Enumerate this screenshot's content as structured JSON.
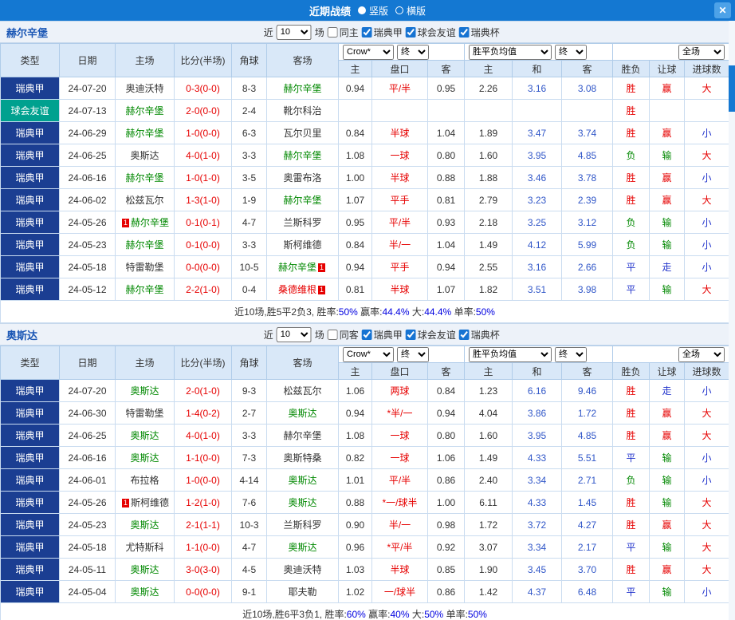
{
  "titlebar": {
    "title": "近期战绩",
    "radio_vertical": "竖版",
    "radio_horizontal": "横版",
    "close": "✕"
  },
  "table_header": {
    "type": "类型",
    "date": "日期",
    "home": "主场",
    "score": "比分(半场)",
    "corners": "角球",
    "away": "客场",
    "odds_select": "Crow*",
    "final_select": "终",
    "avg_select": "胜平负均值",
    "scope_select": "全场",
    "h": "主",
    "hcap": "盘口",
    "a": "客",
    "h2": "主",
    "d": "和",
    "a2": "客",
    "result": "胜负",
    "handicap": "让球",
    "goals": "进球数"
  },
  "sections": [
    {
      "team": "赫尔辛堡",
      "filter": {
        "near": "近",
        "count": "10",
        "games": "场",
        "same": "同主",
        "same_checked": false,
        "leagues": [
          {
            "label": "瑞典甲",
            "checked": true
          },
          {
            "label": "球会友谊",
            "checked": true
          },
          {
            "label": "瑞典杯",
            "checked": true
          }
        ]
      },
      "rows": [
        {
          "league": "瑞典甲",
          "lcls": "league",
          "date": "24-07-20",
          "home": "奥迪沃特",
          "hcls": "n",
          "hbadge": "",
          "score": "0-3(0-0)",
          "corners": "8-3",
          "away": "赫尔辛堡",
          "acls": "g",
          "abadge": "",
          "o_h": "0.94",
          "o_line": "平/半",
          "o_a": "0.95",
          "m_h": "2.26",
          "m_d": "3.16",
          "m_a": "3.08",
          "res": "胜",
          "rescls": "w",
          "hdp": "赢",
          "hdpcls": "w",
          "size": "大",
          "sizecls": "b"
        },
        {
          "league": "球会友谊",
          "lcls": "friendly",
          "date": "24-07-13",
          "home": "赫尔辛堡",
          "hcls": "g",
          "hbadge": "",
          "score": "2-0(0-0)",
          "corners": "2-4",
          "away": "靴尔科治",
          "acls": "n",
          "abadge": "",
          "o_h": "",
          "o_line": "",
          "o_a": "",
          "m_h": "",
          "m_d": "",
          "m_a": "",
          "res": "胜",
          "rescls": "w",
          "hdp": "",
          "hdpcls": "",
          "size": "",
          "sizecls": ""
        },
        {
          "league": "瑞典甲",
          "lcls": "league",
          "date": "24-06-29",
          "home": "赫尔辛堡",
          "hcls": "g",
          "hbadge": "",
          "score": "1-0(0-0)",
          "corners": "6-3",
          "away": "瓦尔贝里",
          "acls": "n",
          "abadge": "",
          "o_h": "0.84",
          "o_line": "半球",
          "o_a": "1.04",
          "m_h": "1.89",
          "m_d": "3.47",
          "m_a": "3.74",
          "res": "胜",
          "rescls": "w",
          "hdp": "赢",
          "hdpcls": "w",
          "size": "小",
          "sizecls": "s"
        },
        {
          "league": "瑞典甲",
          "lcls": "league",
          "date": "24-06-25",
          "home": "奥斯达",
          "hcls": "n",
          "hbadge": "",
          "score": "4-0(1-0)",
          "corners": "3-3",
          "away": "赫尔辛堡",
          "acls": "g",
          "abadge": "",
          "o_h": "1.08",
          "o_line": "一球",
          "o_a": "0.80",
          "m_h": "1.60",
          "m_d": "3.95",
          "m_a": "4.85",
          "res": "负",
          "rescls": "l",
          "hdp": "输",
          "hdpcls": "l",
          "size": "大",
          "sizecls": "b"
        },
        {
          "league": "瑞典甲",
          "lcls": "league",
          "date": "24-06-16",
          "home": "赫尔辛堡",
          "hcls": "g",
          "hbadge": "",
          "score": "1-0(1-0)",
          "corners": "3-5",
          "away": "奥雷布洛",
          "acls": "n",
          "abadge": "",
          "o_h": "1.00",
          "o_line": "半球",
          "o_a": "0.88",
          "m_h": "1.88",
          "m_d": "3.46",
          "m_a": "3.78",
          "res": "胜",
          "rescls": "w",
          "hdp": "赢",
          "hdpcls": "w",
          "size": "小",
          "sizecls": "s"
        },
        {
          "league": "瑞典甲",
          "lcls": "league",
          "date": "24-06-02",
          "home": "松兹瓦尔",
          "hcls": "n",
          "hbadge": "",
          "score": "1-3(1-0)",
          "corners": "1-9",
          "away": "赫尔辛堡",
          "acls": "g",
          "abadge": "",
          "o_h": "1.07",
          "o_line": "平手",
          "o_a": "0.81",
          "m_h": "2.79",
          "m_d": "3.23",
          "m_a": "2.39",
          "res": "胜",
          "rescls": "w",
          "hdp": "赢",
          "hdpcls": "w",
          "size": "大",
          "sizecls": "b"
        },
        {
          "league": "瑞典甲",
          "lcls": "league",
          "date": "24-05-26",
          "home": "赫尔辛堡",
          "hcls": "g",
          "hbadge": "left",
          "score": "0-1(0-1)",
          "corners": "4-7",
          "away": "兰斯科罗",
          "acls": "n",
          "abadge": "",
          "o_h": "0.95",
          "o_line": "平/半",
          "o_a": "0.93",
          "m_h": "2.18",
          "m_d": "3.25",
          "m_a": "3.12",
          "res": "负",
          "rescls": "l",
          "hdp": "输",
          "hdpcls": "l",
          "size": "小",
          "sizecls": "s"
        },
        {
          "league": "瑞典甲",
          "lcls": "league",
          "date": "24-05-23",
          "home": "赫尔辛堡",
          "hcls": "g",
          "hbadge": "",
          "score": "0-1(0-0)",
          "corners": "3-3",
          "away": "斯柯维德",
          "acls": "n",
          "abadge": "",
          "o_h": "0.84",
          "o_line": "半/一",
          "o_a": "1.04",
          "m_h": "1.49",
          "m_d": "4.12",
          "m_a": "5.99",
          "res": "负",
          "rescls": "l",
          "hdp": "输",
          "hdpcls": "l",
          "size": "小",
          "sizecls": "s"
        },
        {
          "league": "瑞典甲",
          "lcls": "league",
          "date": "24-05-18",
          "home": "特雷勒堡",
          "hcls": "n",
          "hbadge": "",
          "score": "0-0(0-0)",
          "corners": "10-5",
          "away": "赫尔辛堡",
          "acls": "g",
          "abadge": "right",
          "o_h": "0.94",
          "o_line": "平手",
          "o_a": "0.94",
          "m_h": "2.55",
          "m_d": "3.16",
          "m_a": "2.66",
          "res": "平",
          "rescls": "p",
          "hdp": "走",
          "hdpcls": "p",
          "size": "小",
          "sizecls": "s"
        },
        {
          "league": "瑞典甲",
          "lcls": "league",
          "date": "24-05-12",
          "home": "赫尔辛堡",
          "hcls": "g",
          "hbadge": "",
          "score": "2-2(1-0)",
          "corners": "0-4",
          "away": "桑德维根",
          "acls": "r",
          "abadge": "right",
          "o_h": "0.81",
          "o_line": "半球",
          "o_a": "1.07",
          "m_h": "1.82",
          "m_d": "3.51",
          "m_a": "3.98",
          "res": "平",
          "rescls": "p",
          "hdp": "输",
          "hdpcls": "l",
          "size": "大",
          "sizecls": "b"
        }
      ],
      "summary": [
        {
          "t": "近10场,胜5平2负3, 胜率:",
          "c": "k"
        },
        {
          "t": "50%",
          "c": "b"
        },
        {
          "t": " 赢率:",
          "c": "k"
        },
        {
          "t": "44.4%",
          "c": "b"
        },
        {
          "t": " 大:",
          "c": "k"
        },
        {
          "t": "44.4%",
          "c": "b"
        },
        {
          "t": " 单率:",
          "c": "k"
        },
        {
          "t": "50%",
          "c": "b"
        }
      ]
    },
    {
      "team": "奥斯达",
      "filter": {
        "near": "近",
        "count": "10",
        "games": "场",
        "same": "同客",
        "same_checked": false,
        "leagues": [
          {
            "label": "瑞典甲",
            "checked": true
          },
          {
            "label": "球会友谊",
            "checked": true
          },
          {
            "label": "瑞典杯",
            "checked": true
          }
        ]
      },
      "rows": [
        {
          "league": "瑞典甲",
          "lcls": "league",
          "date": "24-07-20",
          "home": "奥斯达",
          "hcls": "g",
          "hbadge": "",
          "score": "2-0(1-0)",
          "corners": "9-3",
          "away": "松兹瓦尔",
          "acls": "n",
          "abadge": "",
          "o_h": "1.06",
          "o_line": "两球",
          "o_a": "0.84",
          "m_h": "1.23",
          "m_d": "6.16",
          "m_a": "9.46",
          "res": "胜",
          "rescls": "w",
          "hdp": "走",
          "hdpcls": "p",
          "size": "小",
          "sizecls": "s"
        },
        {
          "league": "瑞典甲",
          "lcls": "league",
          "date": "24-06-30",
          "home": "特雷勒堡",
          "hcls": "n",
          "hbadge": "",
          "score": "1-4(0-2)",
          "corners": "2-7",
          "away": "奥斯达",
          "acls": "g",
          "abadge": "",
          "o_h": "0.94",
          "o_line": "*半/一",
          "o_a": "0.94",
          "m_h": "4.04",
          "m_d": "3.86",
          "m_a": "1.72",
          "res": "胜",
          "rescls": "w",
          "hdp": "赢",
          "hdpcls": "w",
          "size": "大",
          "sizecls": "b"
        },
        {
          "league": "瑞典甲",
          "lcls": "league",
          "date": "24-06-25",
          "home": "奥斯达",
          "hcls": "g",
          "hbadge": "",
          "score": "4-0(1-0)",
          "corners": "3-3",
          "away": "赫尔辛堡",
          "acls": "n",
          "abadge": "",
          "o_h": "1.08",
          "o_line": "一球",
          "o_a": "0.80",
          "m_h": "1.60",
          "m_d": "3.95",
          "m_a": "4.85",
          "res": "胜",
          "rescls": "w",
          "hdp": "赢",
          "hdpcls": "w",
          "size": "大",
          "sizecls": "b"
        },
        {
          "league": "瑞典甲",
          "lcls": "league",
          "date": "24-06-16",
          "home": "奥斯达",
          "hcls": "g",
          "hbadge": "",
          "score": "1-1(0-0)",
          "corners": "7-3",
          "away": "奥斯特桑",
          "acls": "n",
          "abadge": "",
          "o_h": "0.82",
          "o_line": "一球",
          "o_a": "1.06",
          "m_h": "1.49",
          "m_d": "4.33",
          "m_a": "5.51",
          "res": "平",
          "rescls": "p",
          "hdp": "输",
          "hdpcls": "l",
          "size": "小",
          "sizecls": "s"
        },
        {
          "league": "瑞典甲",
          "lcls": "league",
          "date": "24-06-01",
          "home": "布拉格",
          "hcls": "n",
          "hbadge": "",
          "score": "1-0(0-0)",
          "corners": "4-14",
          "away": "奥斯达",
          "acls": "g",
          "abadge": "",
          "o_h": "1.01",
          "o_line": "平/半",
          "o_a": "0.86",
          "m_h": "2.40",
          "m_d": "3.34",
          "m_a": "2.71",
          "res": "负",
          "rescls": "l",
          "hdp": "输",
          "hdpcls": "l",
          "size": "小",
          "sizecls": "s"
        },
        {
          "league": "瑞典甲",
          "lcls": "league",
          "date": "24-05-26",
          "home": "斯柯维德",
          "hcls": "n",
          "hbadge": "left",
          "score": "1-2(1-0)",
          "corners": "7-6",
          "away": "奥斯达",
          "acls": "g",
          "abadge": "",
          "o_h": "0.88",
          "o_line": "*一/球半",
          "o_a": "1.00",
          "m_h": "6.11",
          "m_d": "4.33",
          "m_a": "1.45",
          "res": "胜",
          "rescls": "w",
          "hdp": "输",
          "hdpcls": "l",
          "size": "大",
          "sizecls": "b"
        },
        {
          "league": "瑞典甲",
          "lcls": "league",
          "date": "24-05-23",
          "home": "奥斯达",
          "hcls": "g",
          "hbadge": "",
          "score": "2-1(1-1)",
          "corners": "10-3",
          "away": "兰斯科罗",
          "acls": "n",
          "abadge": "",
          "o_h": "0.90",
          "o_line": "半/一",
          "o_a": "0.98",
          "m_h": "1.72",
          "m_d": "3.72",
          "m_a": "4.27",
          "res": "胜",
          "rescls": "w",
          "hdp": "赢",
          "hdpcls": "w",
          "size": "大",
          "sizecls": "b"
        },
        {
          "league": "瑞典甲",
          "lcls": "league",
          "date": "24-05-18",
          "home": "尤特斯科",
          "hcls": "n",
          "hbadge": "",
          "score": "1-1(0-0)",
          "corners": "4-7",
          "away": "奥斯达",
          "acls": "g",
          "abadge": "",
          "o_h": "0.96",
          "o_line": "*平/半",
          "o_a": "0.92",
          "m_h": "3.07",
          "m_d": "3.34",
          "m_a": "2.17",
          "res": "平",
          "rescls": "p",
          "hdp": "输",
          "hdpcls": "l",
          "size": "大",
          "sizecls": "b"
        },
        {
          "league": "瑞典甲",
          "lcls": "league",
          "date": "24-05-11",
          "home": "奥斯达",
          "hcls": "g",
          "hbadge": "",
          "score": "3-0(3-0)",
          "corners": "4-5",
          "away": "奥迪沃特",
          "acls": "n",
          "abadge": "",
          "o_h": "1.03",
          "o_line": "半球",
          "o_a": "0.85",
          "m_h": "1.90",
          "m_d": "3.45",
          "m_a": "3.70",
          "res": "胜",
          "rescls": "w",
          "hdp": "赢",
          "hdpcls": "w",
          "size": "大",
          "sizecls": "b"
        },
        {
          "league": "瑞典甲",
          "lcls": "league",
          "date": "24-05-04",
          "home": "奥斯达",
          "hcls": "g",
          "hbadge": "",
          "score": "0-0(0-0)",
          "corners": "9-1",
          "away": "耶夫勒",
          "acls": "n",
          "abadge": "",
          "o_h": "1.02",
          "o_line": "一/球半",
          "o_a": "0.86",
          "m_h": "1.42",
          "m_d": "4.37",
          "m_a": "6.48",
          "res": "平",
          "rescls": "p",
          "hdp": "输",
          "hdpcls": "l",
          "size": "小",
          "sizecls": "s"
        }
      ],
      "summary": [
        {
          "t": "近10场,胜6平3负1, 胜率:",
          "c": "k"
        },
        {
          "t": "60%",
          "c": "b"
        },
        {
          "t": " 赢率:",
          "c": "k"
        },
        {
          "t": "40%",
          "c": "b"
        },
        {
          "t": " 大:",
          "c": "k"
        },
        {
          "t": "50%",
          "c": "b"
        },
        {
          "t": " 单率:",
          "c": "k"
        },
        {
          "t": "50%",
          "c": "b"
        }
      ]
    }
  ]
}
